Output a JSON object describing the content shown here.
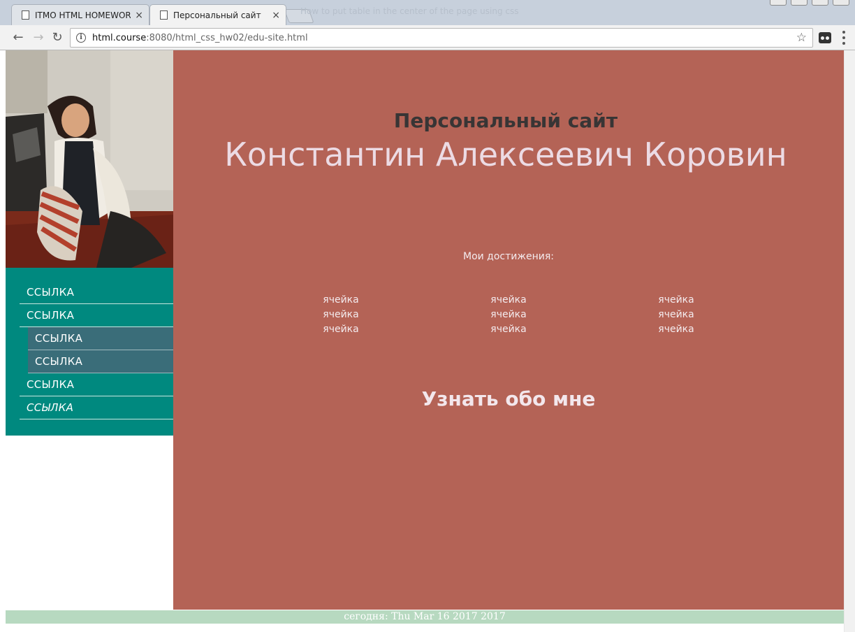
{
  "browser": {
    "tabs": [
      {
        "title": "ITMO HTML HOMEWORK",
        "close": "×"
      },
      {
        "title": "Персональный сайт",
        "close": "×"
      }
    ],
    "ghost_text": "How to put table in the center of the page using css",
    "url_host": "html.course",
    "url_rest": ":8080/html_css_hw02/edu-site.html",
    "back_icon": "←",
    "forward_icon": "→",
    "reload_icon": "↻",
    "info_icon": "i",
    "star_icon": "☆"
  },
  "sidebar": {
    "portrait_alt": "portrait-of-konstantin-korovin",
    "nav": [
      {
        "label": "ССЫЛКА",
        "kind": "top"
      },
      {
        "label": "ССЫЛКА",
        "kind": "top"
      },
      {
        "label": "ССЫЛКА",
        "kind": "sub"
      },
      {
        "label": "ССЫЛКА",
        "kind": "sub"
      },
      {
        "label": "ССЫЛКА",
        "kind": "top"
      },
      {
        "label": "ССЫЛКА",
        "kind": "italic"
      }
    ]
  },
  "main": {
    "subtitle": "Персональный сайт",
    "title": "Константин Алексеевич Коровин",
    "achievements_label": "Мои достижения:",
    "table": [
      [
        "ячейка",
        "ячейка",
        "ячейка"
      ],
      [
        "ячейка",
        "ячейка",
        "ячейка"
      ],
      [
        "ячейка",
        "ячейка",
        "ячейка"
      ]
    ],
    "about": "Узнать обо мне"
  },
  "footer": {
    "text": "сегодня: Thu Mar 16 2017 2017"
  },
  "colors": {
    "main_bg": "#b46356",
    "sidebar_bg": "#00897f",
    "sub_nav_bg": "#3a6d79",
    "footer_bg": "#b7d9c0",
    "title_color": "#ecdbe4",
    "subtitle_color": "#383535"
  }
}
